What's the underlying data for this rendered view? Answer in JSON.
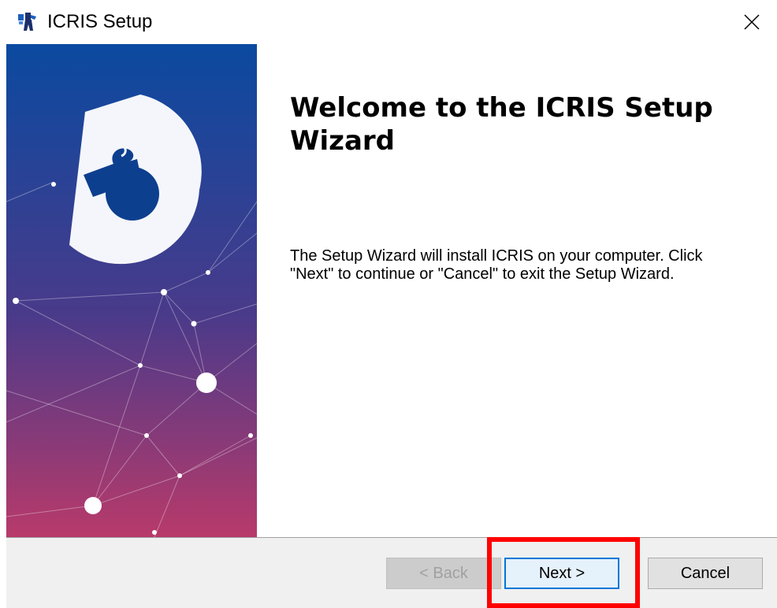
{
  "window": {
    "title": "ICRIS Setup",
    "app_icon": "icris-installer-icon",
    "close_icon": "close-icon"
  },
  "welcome": {
    "title": "Welcome to the ICRIS Setup Wizard",
    "description": "The Setup Wizard will install ICRIS on your computer.  Click\n\"Next\" to continue or \"Cancel\" to exit the Setup Wizard."
  },
  "buttons": {
    "back_label": "< Back",
    "back_enabled": false,
    "next_label": "Next >",
    "cancel_label": "Cancel"
  },
  "banner": {
    "graphic": "puzzle-piece-logo",
    "gradient_top": "#0a4aa0",
    "gradient_bottom": "#b83a6a"
  },
  "annotation": {
    "highlight_color": "#ff0000",
    "highlight_target": "next-button"
  }
}
